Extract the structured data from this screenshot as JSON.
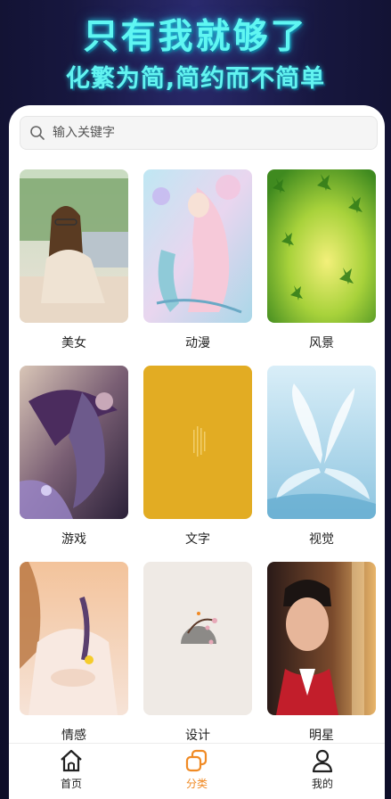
{
  "promo": {
    "headline": "只有我就够了",
    "subheadline": "化繁为简,简约而不简单"
  },
  "search": {
    "placeholder": "输入关键字"
  },
  "categories": [
    {
      "label": "美女"
    },
    {
      "label": "动漫"
    },
    {
      "label": "风景"
    },
    {
      "label": "游戏"
    },
    {
      "label": "文字"
    },
    {
      "label": "视觉"
    },
    {
      "label": "情感"
    },
    {
      "label": "设计"
    },
    {
      "label": "明星"
    }
  ],
  "tabbar": {
    "items": [
      {
        "label": "首页",
        "icon": "home-icon"
      },
      {
        "label": "分类",
        "icon": "category-icon"
      },
      {
        "label": "我的",
        "icon": "profile-icon"
      }
    ],
    "active_index": 1,
    "active_color": "#f08a24"
  }
}
